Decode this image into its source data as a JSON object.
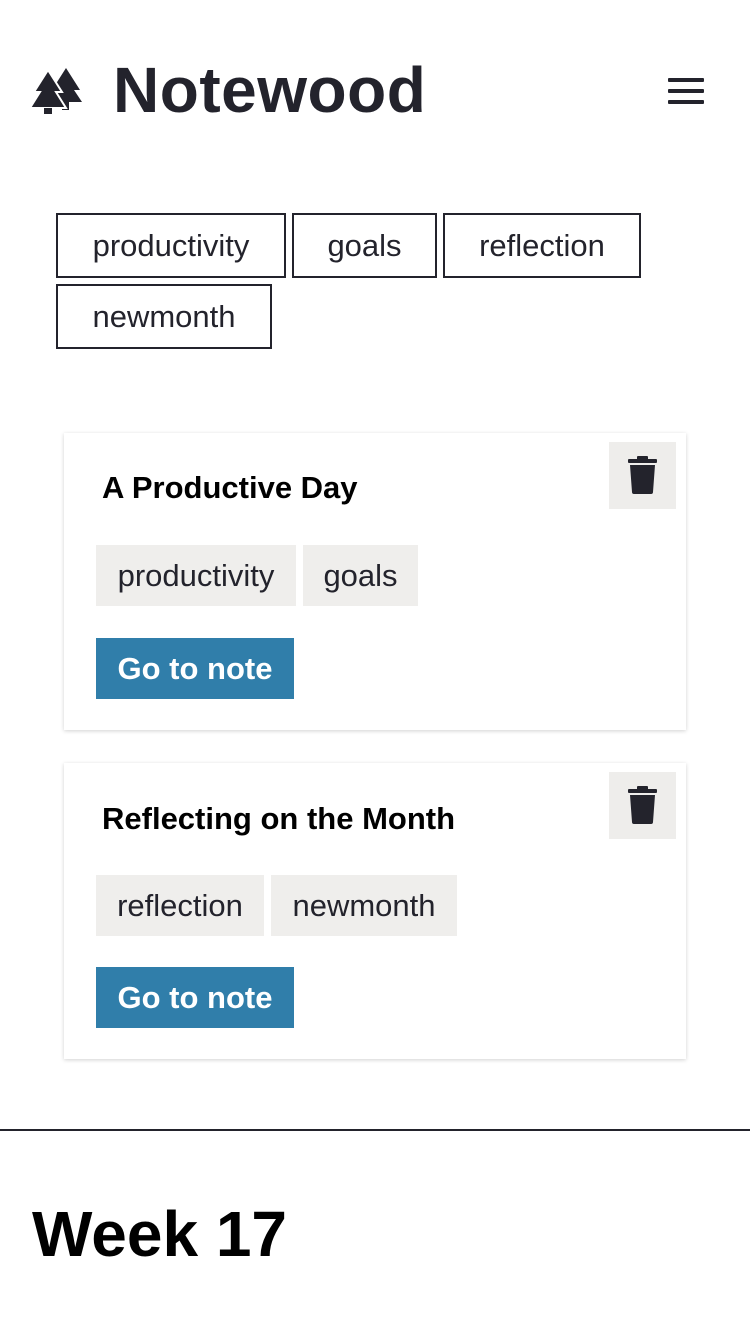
{
  "app": {
    "title": "Notewood",
    "logo_icon": "trees-icon",
    "menu_icon": "hamburger-menu-icon"
  },
  "filter_tags": [
    "productivity",
    "goals",
    "reflection",
    "newmonth"
  ],
  "notes": [
    {
      "title": "A Productive Day",
      "tags": [
        "productivity",
        "goals"
      ],
      "action_label": "Go to note",
      "delete_icon": "trash-icon"
    },
    {
      "title": "Reflecting on the Month",
      "tags": [
        "reflection",
        "newmonth"
      ],
      "action_label": "Go to note",
      "delete_icon": "trash-icon"
    }
  ],
  "section": {
    "heading": "Week 17"
  },
  "colors": {
    "text": "#23232c",
    "accent": "#307eaa",
    "tag_background": "#efeeec"
  }
}
